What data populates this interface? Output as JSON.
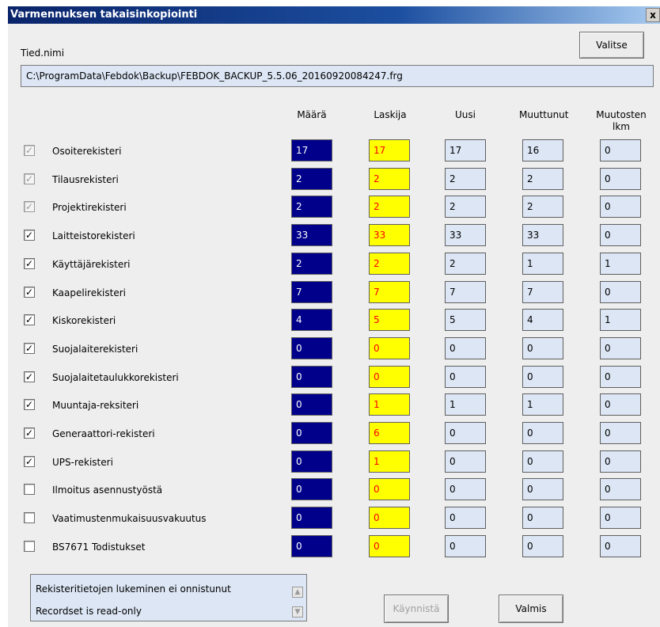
{
  "window": {
    "title": "Varmennuksen takaisinkopiointi",
    "close": "x"
  },
  "file": {
    "label": "Tied.nimi",
    "select_button": "Valitse",
    "path": "C:\\ProgramData\\Febdok\\Backup\\FEBDOK_BACKUP_5.5.06_20160920084247.frg"
  },
  "columns": {
    "maara": "Määrä",
    "laskija": "Laskija",
    "uusi": "Uusi",
    "muuttunut": "Muuttunut",
    "muutosten_lkm_1": "Muutosten",
    "muutosten_lkm_2": "lkm"
  },
  "rows": [
    {
      "name": "Osoiterekisteri",
      "checked": true,
      "disabled": true,
      "maara": "17",
      "laskija": "17",
      "uusi": "17",
      "muuttunut": "16",
      "lkm": "0"
    },
    {
      "name": "Tilausrekisteri",
      "checked": true,
      "disabled": true,
      "maara": "2",
      "laskija": "2",
      "uusi": "2",
      "muuttunut": "2",
      "lkm": "0"
    },
    {
      "name": "Projektirekisteri",
      "checked": true,
      "disabled": true,
      "maara": "2",
      "laskija": "2",
      "uusi": "2",
      "muuttunut": "2",
      "lkm": "0"
    },
    {
      "name": "Laitteistorekisteri",
      "checked": true,
      "disabled": false,
      "maara": "33",
      "laskija": "33",
      "uusi": "33",
      "muuttunut": "33",
      "lkm": "0"
    },
    {
      "name": "Käyttäjärekisteri",
      "checked": true,
      "disabled": false,
      "maara": "2",
      "laskija": "2",
      "uusi": "2",
      "muuttunut": "1",
      "lkm": "1"
    },
    {
      "name": "Kaapelirekisteri",
      "checked": true,
      "disabled": false,
      "maara": "7",
      "laskija": "7",
      "uusi": "7",
      "muuttunut": "7",
      "lkm": "0"
    },
    {
      "name": "Kiskorekisteri",
      "checked": true,
      "disabled": false,
      "maara": "4",
      "laskija": "5",
      "uusi": "5",
      "muuttunut": "4",
      "lkm": "1"
    },
    {
      "name": "Suojalaiterekisteri",
      "checked": true,
      "disabled": false,
      "maara": "0",
      "laskija": "0",
      "uusi": "0",
      "muuttunut": "0",
      "lkm": "0"
    },
    {
      "name": "Suojalaitetaulukkorekisteri",
      "checked": true,
      "disabled": false,
      "maara": "0",
      "laskija": "0",
      "uusi": "0",
      "muuttunut": "0",
      "lkm": "0"
    },
    {
      "name": "Muuntaja-reksiteri",
      "checked": true,
      "disabled": false,
      "maara": "0",
      "laskija": "1",
      "uusi": "1",
      "muuttunut": "1",
      "lkm": "0"
    },
    {
      "name": "Generaattori-rekisteri",
      "checked": true,
      "disabled": false,
      "maara": "0",
      "laskija": "6",
      "uusi": "0",
      "muuttunut": "0",
      "lkm": "0"
    },
    {
      "name": "UPS-rekisteri",
      "checked": true,
      "disabled": false,
      "maara": "0",
      "laskija": "1",
      "uusi": "0",
      "muuttunut": "0",
      "lkm": "0"
    },
    {
      "name": "Ilmoitus asennustyöstä",
      "checked": false,
      "disabled": false,
      "maara": "0",
      "laskija": "0",
      "uusi": "0",
      "muuttunut": "0",
      "lkm": "0"
    },
    {
      "name": "Vaatimustenmukaisuusvakuutus",
      "checked": false,
      "disabled": false,
      "maara": "0",
      "laskija": "0",
      "uusi": "0",
      "muuttunut": "0",
      "lkm": "0"
    },
    {
      "name": "BS7671 Todistukset",
      "checked": false,
      "disabled": false,
      "maara": "0",
      "laskija": "0",
      "uusi": "0",
      "muuttunut": "0",
      "lkm": "0"
    }
  ],
  "status": {
    "lines": [
      "Rekisteritietojen lukeminen ei onnistunut",
      "Recordset is read-only"
    ]
  },
  "buttons": {
    "start": "Käynnistä",
    "done": "Valmis"
  },
  "colors": {
    "maara_bg": "#00008b",
    "maara_fg": "#ffffff",
    "laskija_bg": "#ffff00",
    "laskija_fg": "#ff0000",
    "field_bg": "#dce6f4"
  }
}
